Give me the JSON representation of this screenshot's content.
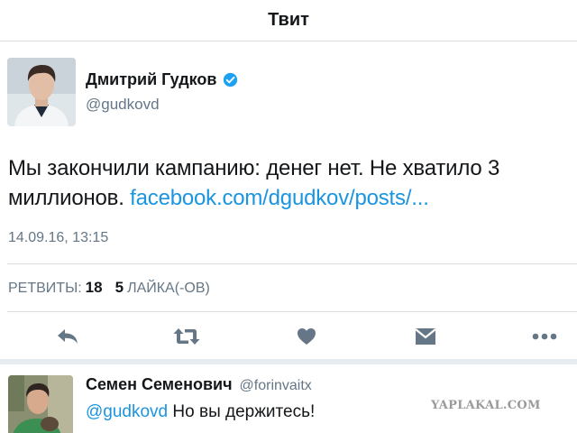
{
  "nav": {
    "title": "Твит"
  },
  "tweet": {
    "author_name": "Дмитрий Гудков",
    "author_handle": "@gudkovd",
    "text": "Мы закончили кампанию: денег нет. Не хватило 3 миллионов.",
    "link": "facebook.com/dgudkov/posts/...",
    "timestamp": "14.09.16, 13:15"
  },
  "stats": {
    "retweets_label": "РЕТВИТЫ:",
    "retweets_count": "18",
    "likes_count": "5",
    "likes_label": "ЛАЙКА(-ОВ)"
  },
  "actions": [
    {
      "icon": "reply-icon"
    },
    {
      "icon": "retweet-icon"
    },
    {
      "icon": "like-heart-icon"
    },
    {
      "icon": "direct-message-icon"
    },
    {
      "icon": "more-icon"
    }
  ],
  "reply": {
    "author_name": "Семен Семенович",
    "author_handle": "@forinvaitx",
    "mention": "@gudkovd",
    "text": "Но вы держитесь!"
  },
  "watermark": "YAPLAKAL.COM",
  "colors": {
    "link": "#1b95e0",
    "verified": "#1da1f2",
    "secondary_text": "#657786",
    "primary_text": "#14171a",
    "divider": "#dcdcdc"
  }
}
